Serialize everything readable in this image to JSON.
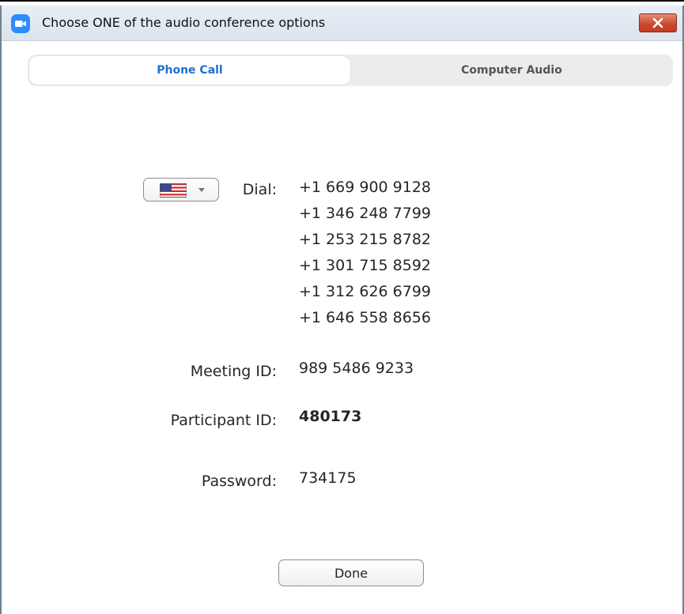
{
  "window": {
    "title": "Choose ONE of the audio conference options"
  },
  "tabs": [
    {
      "label": "Phone Call",
      "selected": true
    },
    {
      "label": "Computer Audio",
      "selected": false
    }
  ],
  "dial": {
    "label": "Dial:",
    "country_icon": "us-flag-icon",
    "numbers": [
      "+1 669 900 9128",
      "+1 346 248 7799",
      "+1 253 215 8782",
      "+1 301 715 8592",
      "+1 312 626 6799",
      "+1 646 558 8656"
    ]
  },
  "meeting": {
    "label": "Meeting ID:",
    "value": "989 5486 9233"
  },
  "participant": {
    "label": "Participant ID:",
    "value": "480173"
  },
  "password": {
    "label": "Password:",
    "value": "734175"
  },
  "buttons": {
    "done_label": "Done"
  },
  "colors": {
    "accent": "#1f6fd0",
    "close_button": "#c8452c",
    "app_icon": "#2e8cff"
  }
}
